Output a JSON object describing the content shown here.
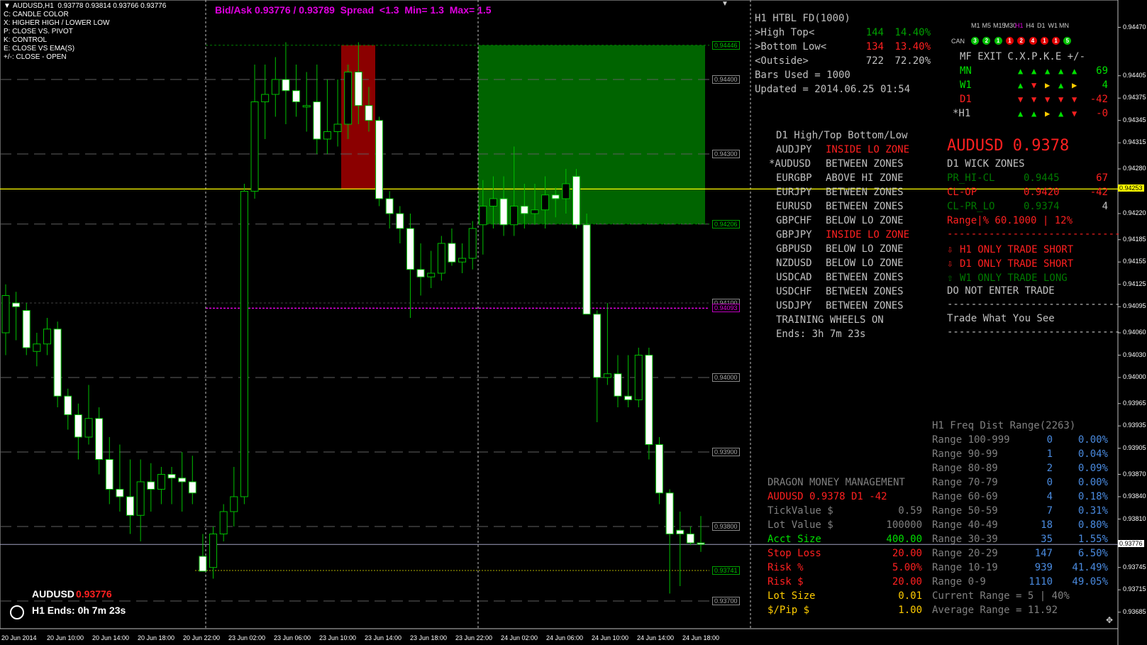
{
  "header": {
    "symbol_info": "AUDUSD,H1  0.93778 0.93814 0.93766 0.93776",
    "legend": [
      "C: CANDLE COLOR",
      "X: HIGHER HIGH / LOWER LOW",
      "P: CLOSE VS. PIVOT",
      "K: CONTROL",
      "E: CLOSE VS EMA(S)",
      "+/-: CLOSE - OPEN"
    ],
    "bidask": "Bid/Ask 0.93776 / 0.93789  Spread  <1.3  Min= 1.3  Max= 1.5"
  },
  "htbl": {
    "title": "H1 HTBL FD(1000)",
    "rows": [
      {
        "label": ">High Top<",
        "count": "144",
        "pct": "14.40%"
      },
      {
        "label": ">Bottom Low<",
        "count": "134",
        "pct": "13.40%"
      },
      {
        "label": "<Outside>",
        "count": "722",
        "pct": "72.20%"
      }
    ],
    "bars_used": "Bars Used = 1000",
    "updated": "Updated = 2014.06.25 01:54"
  },
  "mf": {
    "timeframes": [
      "M1",
      "M5",
      "M15",
      "M30",
      "H1",
      "H4",
      "D1",
      "W1",
      "MN"
    ],
    "can_label": "CAN",
    "can_values": [
      "3",
      "2",
      "1",
      "1",
      "2",
      "4",
      "1",
      "1",
      "5"
    ],
    "can_colors": [
      "#00c000",
      "#00c000",
      "#00c000",
      "#e00000",
      "#e00000",
      "#e00000",
      "#e00000",
      "#e00000",
      "#00c000"
    ],
    "header": "MF EXIT C.X.P.K.E +/-",
    "rows": [
      {
        "tf": "MN",
        "color": "#00e000",
        "arrows": [
          "up",
          "up",
          "up",
          "up",
          "up"
        ],
        "value": "69"
      },
      {
        "tf": "W1",
        "color": "#00e000",
        "arrows": [
          "up",
          "down",
          "right",
          "up",
          "right"
        ],
        "value": "4"
      },
      {
        "tf": "D1",
        "color": "#ff2020",
        "arrows": [
          "down",
          "down",
          "down",
          "down",
          "down"
        ],
        "value": "-42"
      },
      {
        "tf": "*H1",
        "color": "#c0c0c0",
        "arrows": [
          "up",
          "up",
          "right",
          "up",
          "down"
        ],
        "value": "-0"
      }
    ]
  },
  "zones": {
    "title": "D1 High/Top Bottom/Low",
    "rows": [
      {
        "pair": "AUDJPY",
        "status": "INSIDE LO ZONE",
        "red": true
      },
      {
        "pair": "*AUDUSD",
        "status": "BETWEEN ZONES",
        "red": false
      },
      {
        "pair": "EURGBP",
        "status": "ABOVE HI ZONE",
        "red": false
      },
      {
        "pair": "EURJPY",
        "status": "BETWEEN ZONES",
        "red": false
      },
      {
        "pair": "EURUSD",
        "status": "BETWEEN ZONES",
        "red": false
      },
      {
        "pair": "GBPCHF",
        "status": "BELOW LO ZONE",
        "red": false
      },
      {
        "pair": "GBPJPY",
        "status": "INSIDE LO ZONE",
        "red": true
      },
      {
        "pair": "GBPUSD",
        "status": "BELOW LO ZONE",
        "red": false
      },
      {
        "pair": "NZDUSD",
        "status": "BELOW LO ZONE",
        "red": false
      },
      {
        "pair": "USDCAD",
        "status": "BETWEEN ZONES",
        "red": false
      },
      {
        "pair": "USDCHF",
        "status": "BETWEEN ZONES",
        "red": false
      },
      {
        "pair": "USDJPY",
        "status": "BETWEEN ZONES",
        "red": false
      }
    ],
    "training": "TRAINING WHEELS ON",
    "ends": "Ends: 3h 7m 23s"
  },
  "wick": {
    "price_title": "AUDUSD 0.9378",
    "title": "D1 WICK ZONES",
    "rows": [
      {
        "label": "PR_HI-CL",
        "value": "0.9445",
        "num": "67",
        "color": "#007a00",
        "numcolor": "#ff2020"
      },
      {
        "label": "CL-OP",
        "value": "0.9420",
        "num": "-42",
        "color": "#ff2020",
        "numcolor": "#ff2020"
      },
      {
        "label": "CL-PR_LO",
        "value": "0.9374",
        "num": "4",
        "color": "#007a00",
        "numcolor": "#c0c0c0"
      }
    ],
    "range": "Range|% 60.1000 | 12%",
    "signals": [
      {
        "arrow": "⇩",
        "text": "H1 ONLY TRADE SHORT",
        "color": "#ff2020"
      },
      {
        "arrow": "⇩",
        "text": "D1 ONLY TRADE SHORT",
        "color": "#ff2020"
      },
      {
        "arrow": "⇧",
        "text": "W1 ONLY TRADE LONG",
        "color": "#007a00"
      }
    ],
    "no_enter": "DO NOT ENTER TRADE",
    "divider": "-----------------------------",
    "wysee": "Trade What You See"
  },
  "freq": {
    "title": "H1 Freq Dist Range(2263)",
    "rows": [
      {
        "label": "Range 100-999",
        "count": "0",
        "pct": "0.00%"
      },
      {
        "label": "Range 90-99",
        "count": "1",
        "pct": "0.04%"
      },
      {
        "label": "Range 80-89",
        "count": "2",
        "pct": "0.09%"
      },
      {
        "label": "Range 70-79",
        "count": "0",
        "pct": "0.00%"
      },
      {
        "label": "Range 60-69",
        "count": "4",
        "pct": "0.18%"
      },
      {
        "label": "Range 50-59",
        "count": "7",
        "pct": "0.31%"
      },
      {
        "label": "Range 40-49",
        "count": "18",
        "pct": "0.80%"
      },
      {
        "label": "Range 30-39",
        "count": "35",
        "pct": "1.55%"
      },
      {
        "label": "Range 20-29",
        "count": "147",
        "pct": "6.50%"
      },
      {
        "label": "Range 10-19",
        "count": "939",
        "pct": "41.49%"
      },
      {
        "label": "Range 0-9",
        "count": "1110",
        "pct": "49.05%"
      }
    ],
    "current": "Current Range = 5 | 40%",
    "average": "Average Range = 11.92"
  },
  "mm": {
    "title": "DRAGON MONEY MANAGEMENT",
    "sub": "AUDUSD 0.9378 D1 -42",
    "rows": [
      {
        "label": "TickValue $",
        "value": "0.59",
        "color": "#808080"
      },
      {
        "label": "Lot Value $",
        "value": "100000",
        "color": "#808080"
      },
      {
        "label": "Acct Size",
        "value": "400.00",
        "color": "#00e000"
      },
      {
        "label": "Stop Loss",
        "value": "20.00",
        "color": "#ff2020"
      },
      {
        "label": "Risk %",
        "value": "5.00%",
        "color": "#ff2020"
      },
      {
        "label": "Risk $",
        "value": "20.00",
        "color": "#ff2020"
      },
      {
        "label": "Lot Size",
        "value": "0.01",
        "color": "#ffcc00"
      },
      {
        "label": "$/Pip $",
        "value": "1.00",
        "color": "#ffcc00"
      }
    ]
  },
  "bottom_info": {
    "symbol": "AUDUSD",
    "price": "0.93776",
    "ends": "H1 Ends: 0h 7m 23s"
  },
  "price_axis": {
    "labels": [
      "0.94470",
      "0.94405",
      "0.94375",
      "0.94345",
      "0.94315",
      "0.94280",
      "0.94253",
      "0.94220",
      "0.94185",
      "0.94155",
      "0.94125",
      "0.94095",
      "0.94060",
      "0.94030",
      "0.94000",
      "0.93965",
      "0.93935",
      "0.93905",
      "0.93870",
      "0.93840",
      "0.93810",
      "0.93776",
      "0.93745",
      "0.93715",
      "0.93685"
    ],
    "current": "0.94253",
    "last": "0.93776"
  },
  "chart_boxes": {
    "labels": [
      "0.94446",
      "0.94400",
      "0.94300",
      "0.94206",
      "0.94100",
      "0.94093",
      "0.94000",
      "0.93900",
      "0.93800",
      "0.93741",
      "0.93700"
    ]
  },
  "time_axis": {
    "labels": [
      "20 Jun 2014",
      "20 Jun 10:00",
      "20 Jun 14:00",
      "20 Jun 18:00",
      "20 Jun 22:00",
      "23 Jun 02:00",
      "23 Jun 06:00",
      "23 Jun 10:00",
      "23 Jun 14:00",
      "23 Jun 18:00",
      "23 Jun 22:00",
      "24 Jun 02:00",
      "24 Jun 06:00",
      "24 Jun 10:00",
      "24 Jun 14:00",
      "24 Jun 18:00"
    ]
  },
  "chart_data": {
    "type": "candlestick",
    "symbol": "AUDUSD",
    "timeframe": "H1",
    "ylim": [
      0.9368,
      0.9448
    ],
    "candles": [
      {
        "o": 0.9406,
        "h": 0.94125,
        "l": 0.9403,
        "c": 0.9411
      },
      {
        "o": 0.941,
        "h": 0.94115,
        "l": 0.9405,
        "c": 0.94095
      },
      {
        "o": 0.9409,
        "h": 0.941,
        "l": 0.9403,
        "c": 0.9404
      },
      {
        "o": 0.94035,
        "h": 0.9406,
        "l": 0.94015,
        "c": 0.94045
      },
      {
        "o": 0.94045,
        "h": 0.9408,
        "l": 0.9403,
        "c": 0.94065
      },
      {
        "o": 0.94065,
        "h": 0.94075,
        "l": 0.9396,
        "c": 0.93975
      },
      {
        "o": 0.93975,
        "h": 0.93985,
        "l": 0.9393,
        "c": 0.9395
      },
      {
        "o": 0.9395,
        "h": 0.93965,
        "l": 0.9389,
        "c": 0.9392
      },
      {
        "o": 0.9392,
        "h": 0.9399,
        "l": 0.9391,
        "c": 0.93945
      },
      {
        "o": 0.93945,
        "h": 0.9396,
        "l": 0.9387,
        "c": 0.9389
      },
      {
        "o": 0.9389,
        "h": 0.9392,
        "l": 0.9383,
        "c": 0.9385
      },
      {
        "o": 0.9385,
        "h": 0.9391,
        "l": 0.9382,
        "c": 0.9384
      },
      {
        "o": 0.9384,
        "h": 0.9389,
        "l": 0.9379,
        "c": 0.93815
      },
      {
        "o": 0.93815,
        "h": 0.9389,
        "l": 0.9378,
        "c": 0.9386
      },
      {
        "o": 0.9386,
        "h": 0.93885,
        "l": 0.9382,
        "c": 0.9385
      },
      {
        "o": 0.9385,
        "h": 0.9388,
        "l": 0.9383,
        "c": 0.9387
      },
      {
        "o": 0.9387,
        "h": 0.9388,
        "l": 0.9383,
        "c": 0.93865
      },
      {
        "o": 0.93865,
        "h": 0.939,
        "l": 0.9382,
        "c": 0.9386
      },
      {
        "o": 0.9386,
        "h": 0.93895,
        "l": 0.9383,
        "c": 0.93845
      },
      {
        "o": 0.9376,
        "h": 0.9379,
        "l": 0.9374,
        "c": 0.9374
      },
      {
        "o": 0.93745,
        "h": 0.938,
        "l": 0.9373,
        "c": 0.9379
      },
      {
        "o": 0.9379,
        "h": 0.9383,
        "l": 0.9378,
        "c": 0.9382
      },
      {
        "o": 0.9382,
        "h": 0.9388,
        "l": 0.938,
        "c": 0.9384
      },
      {
        "o": 0.9384,
        "h": 0.9426,
        "l": 0.9383,
        "c": 0.9425
      },
      {
        "o": 0.9425,
        "h": 0.9442,
        "l": 0.9424,
        "c": 0.9437
      },
      {
        "o": 0.9437,
        "h": 0.9442,
        "l": 0.9432,
        "c": 0.9438
      },
      {
        "o": 0.9438,
        "h": 0.9443,
        "l": 0.9435,
        "c": 0.944
      },
      {
        "o": 0.944,
        "h": 0.9445,
        "l": 0.9434,
        "c": 0.94385
      },
      {
        "o": 0.94385,
        "h": 0.9442,
        "l": 0.9435,
        "c": 0.9437
      },
      {
        "o": 0.94365,
        "h": 0.9441,
        "l": 0.9433,
        "c": 0.94365
      },
      {
        "o": 0.9437,
        "h": 0.9442,
        "l": 0.943,
        "c": 0.9432
      },
      {
        "o": 0.9432,
        "h": 0.944,
        "l": 0.943,
        "c": 0.9433
      },
      {
        "o": 0.9433,
        "h": 0.944,
        "l": 0.9431,
        "c": 0.9434
      },
      {
        "o": 0.9434,
        "h": 0.9442,
        "l": 0.9432,
        "c": 0.9441
      },
      {
        "o": 0.9441,
        "h": 0.9445,
        "l": 0.9434,
        "c": 0.94365
      },
      {
        "o": 0.94365,
        "h": 0.9439,
        "l": 0.9433,
        "c": 0.94345
      },
      {
        "o": 0.94345,
        "h": 0.9435,
        "l": 0.9423,
        "c": 0.9424
      },
      {
        "o": 0.9424,
        "h": 0.9425,
        "l": 0.942,
        "c": 0.9422
      },
      {
        "o": 0.9422,
        "h": 0.9423,
        "l": 0.9418,
        "c": 0.942
      },
      {
        "o": 0.942,
        "h": 0.9422,
        "l": 0.9408,
        "c": 0.94145
      },
      {
        "o": 0.94145,
        "h": 0.9418,
        "l": 0.9411,
        "c": 0.94135
      },
      {
        "o": 0.94135,
        "h": 0.9417,
        "l": 0.9412,
        "c": 0.9414
      },
      {
        "o": 0.9414,
        "h": 0.9419,
        "l": 0.9413,
        "c": 0.9418
      },
      {
        "o": 0.9418,
        "h": 0.942,
        "l": 0.9415,
        "c": 0.94155
      },
      {
        "o": 0.94155,
        "h": 0.9418,
        "l": 0.9414,
        "c": 0.9416
      },
      {
        "o": 0.9416,
        "h": 0.9421,
        "l": 0.94145,
        "c": 0.942
      },
      {
        "o": 0.94205,
        "h": 0.94265,
        "l": 0.94165,
        "c": 0.9423
      },
      {
        "o": 0.9423,
        "h": 0.9427,
        "l": 0.942,
        "c": 0.9424
      },
      {
        "o": 0.9424,
        "h": 0.9427,
        "l": 0.9419,
        "c": 0.94205
      },
      {
        "o": 0.94205,
        "h": 0.9431,
        "l": 0.9419,
        "c": 0.9423
      },
      {
        "o": 0.9423,
        "h": 0.9426,
        "l": 0.942,
        "c": 0.9422
      },
      {
        "o": 0.9422,
        "h": 0.9426,
        "l": 0.94205,
        "c": 0.94225
      },
      {
        "o": 0.94225,
        "h": 0.9427,
        "l": 0.942,
        "c": 0.94245
      },
      {
        "o": 0.94245,
        "h": 0.94255,
        "l": 0.94215,
        "c": 0.9424
      },
      {
        "o": 0.9424,
        "h": 0.9428,
        "l": 0.9422,
        "c": 0.9426
      },
      {
        "o": 0.9427,
        "h": 0.9428,
        "l": 0.942,
        "c": 0.94205
      },
      {
        "o": 0.94205,
        "h": 0.9422,
        "l": 0.94085,
        "c": 0.94085
      },
      {
        "o": 0.94085,
        "h": 0.9409,
        "l": 0.9394,
        "c": 0.94
      },
      {
        "o": 0.94,
        "h": 0.941,
        "l": 0.9399,
        "c": 0.94005
      },
      {
        "o": 0.94005,
        "h": 0.9403,
        "l": 0.9396,
        "c": 0.93975
      },
      {
        "o": 0.93975,
        "h": 0.9403,
        "l": 0.9396,
        "c": 0.9397
      },
      {
        "o": 0.9397,
        "h": 0.9404,
        "l": 0.9396,
        "c": 0.9403
      },
      {
        "o": 0.9403,
        "h": 0.9404,
        "l": 0.9389,
        "c": 0.9391
      },
      {
        "o": 0.9391,
        "h": 0.9392,
        "l": 0.9383,
        "c": 0.93845
      },
      {
        "o": 0.93845,
        "h": 0.9385,
        "l": 0.9371,
        "c": 0.9379
      },
      {
        "o": 0.93795,
        "h": 0.9382,
        "l": 0.9372,
        "c": 0.9379
      },
      {
        "o": 0.9379,
        "h": 0.938,
        "l": 0.93775,
        "c": 0.93778
      },
      {
        "o": 0.93778,
        "h": 0.93814,
        "l": 0.93766,
        "c": 0.93776
      }
    ],
    "lines": {
      "current_price": 0.94253,
      "last_price": 0.93776,
      "magenta": 0.94093,
      "dashed": [
        0.944,
        0.943,
        0.94206,
        0.94,
        0.939,
        0.938,
        0.937
      ]
    }
  }
}
